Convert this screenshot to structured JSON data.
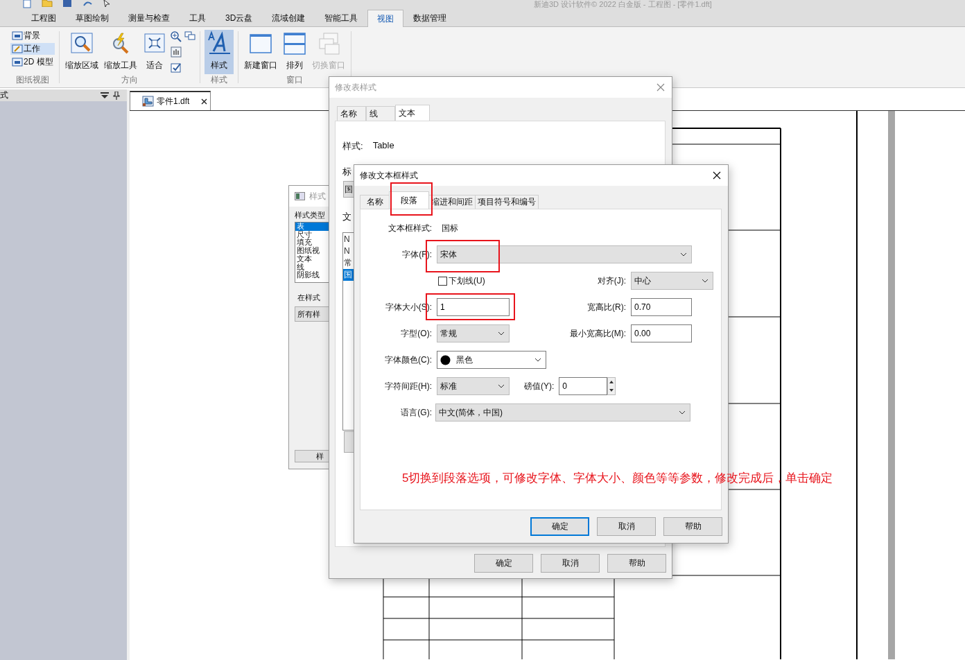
{
  "title_bar": {
    "title": "新迪3D 设计软件© 2022 白金版 - 工程图 - [零件1.dft]"
  },
  "ribbon_tabs": [
    {
      "label": "工程图",
      "selected": false
    },
    {
      "label": "草图绘制",
      "selected": false
    },
    {
      "label": "测量与检查",
      "selected": false
    },
    {
      "label": "工具",
      "selected": false
    },
    {
      "label": "3D云盘",
      "selected": false
    },
    {
      "label": "流域创建",
      "selected": false
    },
    {
      "label": "智能工具",
      "selected": false
    },
    {
      "label": "视图",
      "selected": true
    },
    {
      "label": "数据管理",
      "selected": false
    }
  ],
  "ribbon": {
    "drawing_views": {
      "label": "图纸视图",
      "items": [
        {
          "label": "背景",
          "selected": false
        },
        {
          "label": "工作",
          "selected": true
        },
        {
          "label": "2D 模型",
          "selected": false
        }
      ]
    },
    "orientation": {
      "label": "方向",
      "buttons": [
        "缩放区域",
        "缩放工具",
        "适合"
      ]
    },
    "style": {
      "label": "样式",
      "button": {
        "label": "样式",
        "selected": true
      }
    },
    "window": {
      "label": "窗口",
      "buttons": [
        {
          "label": "新建窗口",
          "disabled": false
        },
        {
          "label": "排列",
          "disabled": false
        },
        {
          "label": "切换窗口",
          "disabled": true
        }
      ]
    }
  },
  "side_panel": {
    "header": "式"
  },
  "document_tab": {
    "label": "零件1.dft"
  },
  "style_dialog": {
    "title": "样式",
    "type_label": "样式类型",
    "types": [
      {
        "label": "表",
        "selected": true
      },
      {
        "label": "尺寸",
        "selected": false
      },
      {
        "label": "填充",
        "selected": false
      },
      {
        "label": "图纸视",
        "selected": false
      },
      {
        "label": "文本",
        "selected": false
      },
      {
        "label": "线",
        "selected": false
      },
      {
        "label": "阴影线",
        "selected": false
      }
    ],
    "filter_label": "在样式",
    "filter_value": "所有样",
    "button": "样"
  },
  "table_style_dialog": {
    "title": "修改表样式",
    "tabs": [
      {
        "label": "名称",
        "selected": false
      },
      {
        "label": "线",
        "selected": false
      },
      {
        "label": "文本",
        "selected": true
      }
    ],
    "style_label": "样式:",
    "style_value": "Table",
    "title_label": "标",
    "title_value": "国",
    "text_label": "文",
    "styles": [
      {
        "label": "N",
        "selected": false
      },
      {
        "label": "N",
        "selected": false
      },
      {
        "label": "常",
        "selected": false
      },
      {
        "label": "国",
        "selected": true
      }
    ],
    "buttons": [
      "确定",
      "取消",
      "帮助"
    ]
  },
  "text_box_dialog": {
    "title": "修改文本框样式",
    "tabs": [
      {
        "label": "名称",
        "selected": false
      },
      {
        "label": "段落",
        "selected": true
      },
      {
        "label": "缩进和间距",
        "selected": false
      },
      {
        "label": "项目符号和编号",
        "selected": false
      }
    ],
    "style_label": "文本框样式:",
    "style_value": "国标",
    "font": {
      "label": "字体(F):",
      "value": "宋体"
    },
    "underline": {
      "label": "下划线(U)",
      "checked": false
    },
    "align": {
      "label": "对齐(J):",
      "value": "中心"
    },
    "size": {
      "label": "字体大小(S):",
      "value": "1"
    },
    "ratio": {
      "label": "宽高比(R):",
      "value": "0.70"
    },
    "face": {
      "label": "字型(O):",
      "value": "常规"
    },
    "min_ratio": {
      "label": "最小宽高比(M):",
      "value": "0.00"
    },
    "color": {
      "label": "字体颜色(C):",
      "value": "黑色"
    },
    "spacing": {
      "label": "字符间距(H):",
      "value": "标准"
    },
    "points": {
      "label": "磅值(Y):",
      "value": "0"
    },
    "language": {
      "label": "语言(G):",
      "value": "中文(简体，中国)"
    },
    "buttons": [
      {
        "label": "确定",
        "default": true
      },
      {
        "label": "取消",
        "default": false
      },
      {
        "label": "帮助",
        "default": false
      }
    ]
  },
  "annotation": {
    "text": "5切换到段落选项，可修改字体、字体大小、颜色等等参数，修改完成后，单击确定"
  }
}
